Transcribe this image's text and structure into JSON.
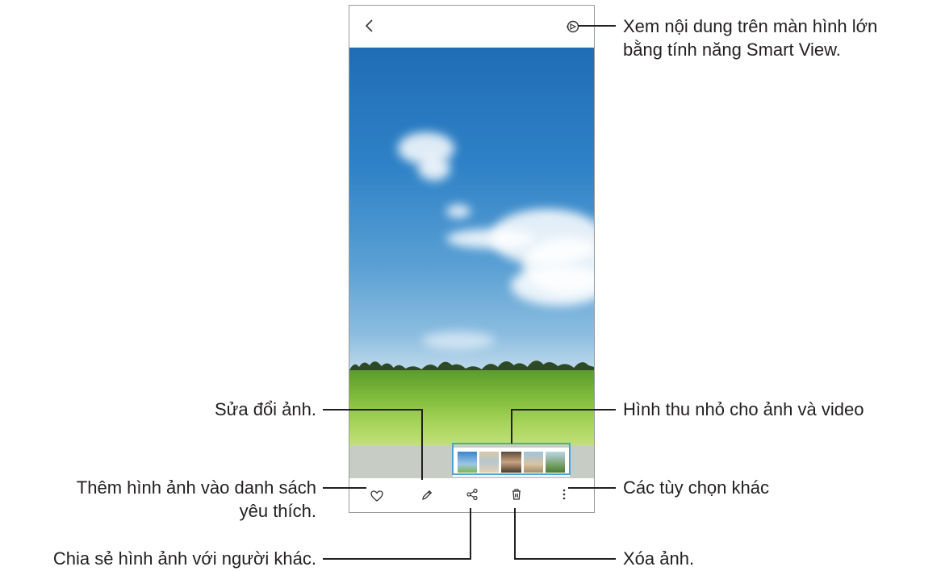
{
  "annotations": {
    "smart_view": [
      "Xem nội dung trên màn hình lớn",
      "bằng tính năng Smart View."
    ],
    "edit": "Sửa đổi ảnh.",
    "thumbnails": "Hình thu nhỏ cho ảnh và video",
    "favorite": [
      "Thêm hình ảnh vào danh sách",
      "yêu thích."
    ],
    "more_options": "Các tùy chọn khác",
    "share": "Chia sẻ hình ảnh với người khác.",
    "delete": "Xóa ảnh."
  },
  "icons": {
    "back": "chevron-left-icon",
    "smart_view": "smart-view-icon",
    "favorite": "heart-icon",
    "edit": "pencil-icon",
    "share": "share-icon",
    "delete": "trash-icon",
    "more": "more-vertical-icon"
  },
  "colors": {
    "highlight": "#4aa3d8",
    "line": "#231f20",
    "sky_top": "#1f6db5",
    "field": "#7fbb3a"
  },
  "thumbnails": [
    "thumbnail-1",
    "thumbnail-2",
    "thumbnail-3",
    "thumbnail-4",
    "thumbnail-5"
  ]
}
